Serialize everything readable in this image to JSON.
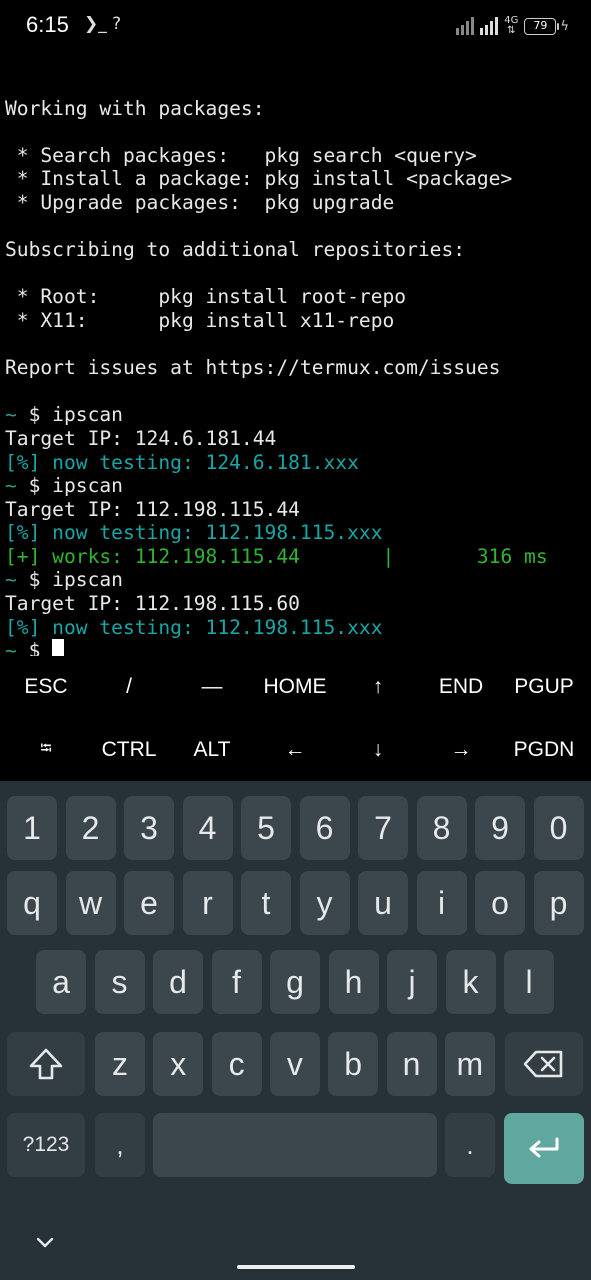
{
  "status_bar": {
    "time": "6:15",
    "left_icons": "❯_ ?",
    "network_label": "4G",
    "battery_level": "79",
    "icons": [
      "terminal-icon",
      "no-sim-signal-icon",
      "signal-icon",
      "signal-icon",
      "battery-icon",
      "charging-icon"
    ]
  },
  "terminal": {
    "lines": [
      {
        "text": "",
        "color": "white"
      },
      {
        "text": "Working with packages:",
        "color": "white"
      },
      {
        "text": "",
        "color": "white"
      },
      {
        "text": " * Search packages:   pkg search <query>",
        "color": "white"
      },
      {
        "text": " * Install a package: pkg install <package>",
        "color": "white"
      },
      {
        "text": " * Upgrade packages:  pkg upgrade",
        "color": "white"
      },
      {
        "text": "",
        "color": "white"
      },
      {
        "text": "Subscribing to additional repositories:",
        "color": "white"
      },
      {
        "text": "",
        "color": "white"
      },
      {
        "text": " * Root:     pkg install root-repo",
        "color": "white"
      },
      {
        "text": " * X11:      pkg install x11-repo",
        "color": "white"
      },
      {
        "text": "",
        "color": "white"
      },
      {
        "text": "Report issues at https://termux.com/issues",
        "color": "white"
      },
      {
        "text": "",
        "color": "white"
      },
      {
        "prompt": "~",
        "text": " $ ipscan",
        "color": "white"
      },
      {
        "text": "Target IP: 124.6.181.44",
        "color": "white"
      },
      {
        "text": "[%] now testing: 124.6.181.xxx",
        "color": "cyan"
      },
      {
        "prompt": "~",
        "text": " $ ipscan",
        "color": "white"
      },
      {
        "text": "Target IP: 112.198.115.44",
        "color": "white"
      },
      {
        "text": "[%] now testing: 112.198.115.xxx",
        "color": "cyan"
      },
      {
        "text": "[+] works: 112.198.115.44       |       316 ms",
        "color": "green"
      },
      {
        "prompt": "~",
        "text": " $ ipscan",
        "color": "white"
      },
      {
        "text": "Target IP: 112.198.115.60",
        "color": "white"
      },
      {
        "text": "[%] now testing: 112.198.115.xxx",
        "color": "cyan"
      },
      {
        "prompt": "~",
        "text": " $ ",
        "color": "white",
        "cursor": true
      }
    ]
  },
  "extra_keys": {
    "row1": [
      "ESC",
      "/",
      "—",
      "HOME",
      "↑",
      "END",
      "PGUP"
    ],
    "row2": [
      "⭾",
      "CTRL",
      "ALT",
      "←",
      "↓",
      "→",
      "PGDN"
    ]
  },
  "keyboard": {
    "numbers": [
      "1",
      "2",
      "3",
      "4",
      "5",
      "6",
      "7",
      "8",
      "9",
      "0"
    ],
    "row1": [
      "q",
      "w",
      "e",
      "r",
      "t",
      "y",
      "u",
      "i",
      "o",
      "p"
    ],
    "row2": [
      "a",
      "s",
      "d",
      "f",
      "g",
      "h",
      "j",
      "k",
      "l"
    ],
    "row3": [
      "z",
      "x",
      "c",
      "v",
      "b",
      "n",
      "m"
    ],
    "symbols_label": "?123",
    "comma": ",",
    "period": ".",
    "colors": {
      "background": "#263238",
      "key": "#3c474d",
      "function_key": "#323e44",
      "enter": "#5fa79f"
    }
  }
}
